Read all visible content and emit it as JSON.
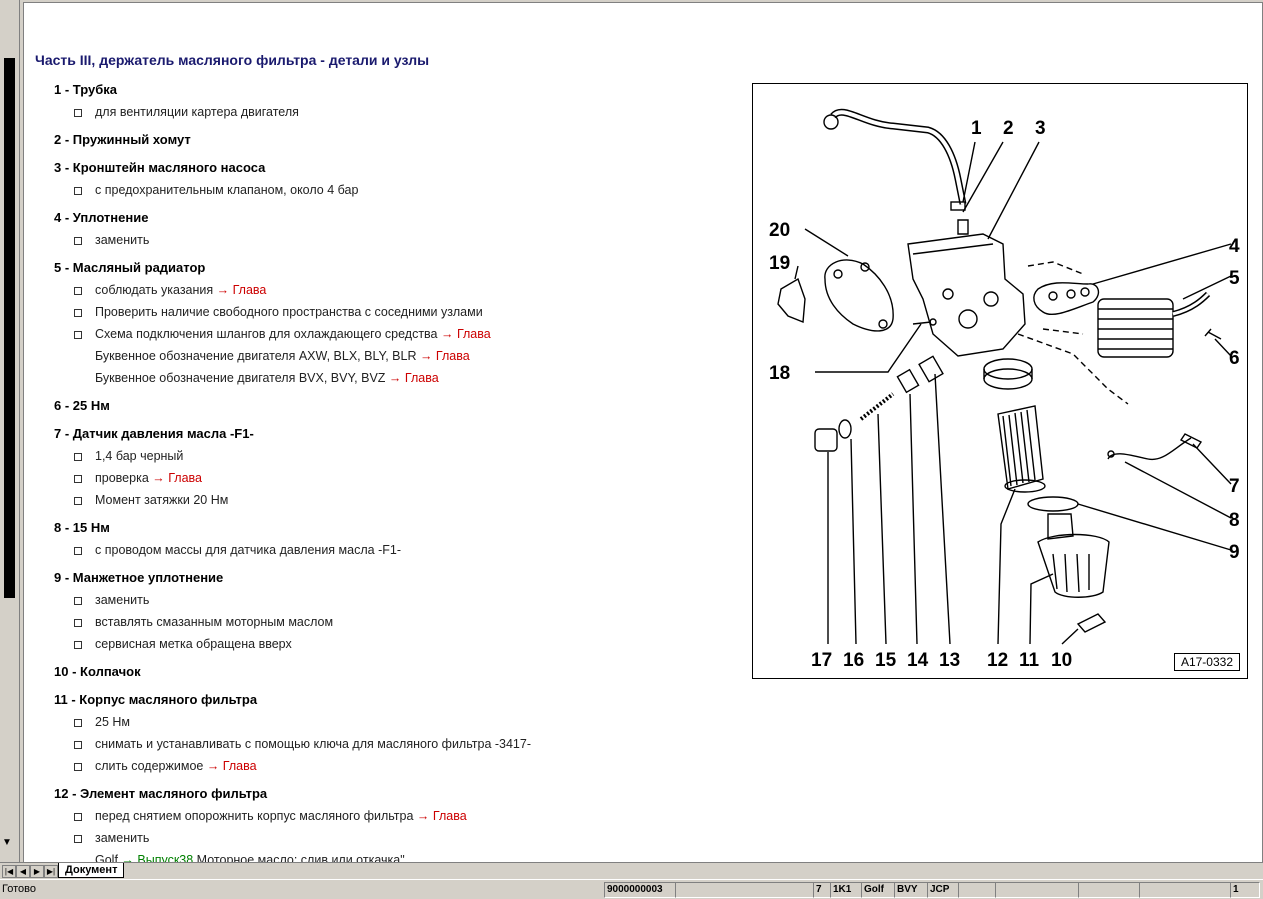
{
  "document": {
    "title": "Часть III, держатель масляного фильтра - детали и узлы",
    "items": [
      {
        "head": "1 - Трубка",
        "subs": [
          {
            "type": "bullet",
            "text": "для вентиляции картера двигателя"
          }
        ]
      },
      {
        "head": "2 - Пружинный хомут",
        "subs": []
      },
      {
        "head": "3 - Кронштейн масляного насоса",
        "subs": [
          {
            "type": "bullet",
            "text": "с предохранительным клапаном, около 4 бар"
          }
        ]
      },
      {
        "head": "4 - Уплотнение",
        "subs": [
          {
            "type": "bullet",
            "text": "заменить"
          }
        ]
      },
      {
        "head": "5 - Масляный радиатор",
        "subs": [
          {
            "type": "bullet",
            "text": "соблюдать указания ",
            "link": "→ Глава"
          },
          {
            "type": "bullet",
            "text": "Проверить наличие свободного пространства с соседними узлами"
          },
          {
            "type": "bullet",
            "text": "Схема подключения шлангов для охлаждающего средства ",
            "link": "→ Глава"
          },
          {
            "type": "plain",
            "text": "Буквенное обозначение двигателя AXW, BLX, BLY, BLR ",
            "link": "→ Глава"
          },
          {
            "type": "plain",
            "text": "Буквенное обозначение двигателя BVX, BVY, BVZ ",
            "link": "→ Глава"
          }
        ]
      },
      {
        "head": "6 - 25 Нм",
        "subs": []
      },
      {
        "head": "7 - Датчик давления масла -F1-",
        "subs": [
          {
            "type": "bullet",
            "text": "1,4 бар черный"
          },
          {
            "type": "bullet",
            "text": "проверка ",
            "link": "→ Глава"
          },
          {
            "type": "bullet",
            "text": "Момент затяжки 20 Нм"
          }
        ]
      },
      {
        "head": "8 - 15 Нм",
        "subs": [
          {
            "type": "bullet",
            "text": "с проводом массы для датчика давления масла -F1-"
          }
        ]
      },
      {
        "head": "9 - Манжетное уплотнение",
        "subs": [
          {
            "type": "bullet",
            "text": "заменить"
          },
          {
            "type": "bullet",
            "text": "вставлять смазанным моторным маслом"
          },
          {
            "type": "bullet",
            "text": "сервисная метка обращена вверх"
          }
        ]
      },
      {
        "head": "10 - Колпачок",
        "subs": []
      },
      {
        "head": "11 - Корпус масляного фильтра",
        "subs": [
          {
            "type": "bullet",
            "text": "25 Нм"
          },
          {
            "type": "bullet",
            "text": "снимать и устанавливать с помощью ключа для масляного фильтра -3417-"
          },
          {
            "type": "bullet",
            "text": "слить содержимое ",
            "link": "→ Глава"
          }
        ]
      },
      {
        "head": "12 - Элемент масляного фильтра",
        "subs": [
          {
            "type": "bullet",
            "text": "перед снятием опорожнить корпус масляного фильтра ",
            "link": "→ Глава"
          },
          {
            "type": "bullet",
            "text": "заменить"
          },
          {
            "type": "plain",
            "text": "Golf ",
            "link_green": "→ Выпуск38",
            "after": " Моторное масло: слив или откачка\""
          }
        ]
      }
    ]
  },
  "figure": {
    "code": "A17-0332",
    "callouts_top": [
      "1",
      "2",
      "3"
    ],
    "callouts_right": [
      "4",
      "5",
      "6",
      "7",
      "8",
      "9"
    ],
    "callouts_left": [
      "20",
      "19",
      "18"
    ],
    "callouts_bottom": [
      "17",
      "16",
      "15",
      "14",
      "13",
      "12",
      "11",
      "10"
    ]
  },
  "tabs": {
    "active": "Документ"
  },
  "status": {
    "text": "Готово",
    "doc_number": "9000000003",
    "cells": [
      "7",
      "1K1",
      "Golf",
      "BVY",
      "JCP"
    ],
    "page": "1"
  },
  "icons": {
    "first": "first-page-icon",
    "prev": "prev-page-icon",
    "next": "next-page-icon",
    "last": "last-page-icon"
  }
}
